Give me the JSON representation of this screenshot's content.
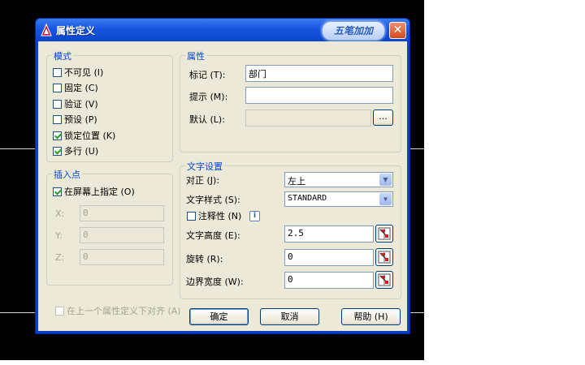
{
  "dialog": {
    "title": "属性定义",
    "brand_text": "五笔加加",
    "close_symbol": "✕"
  },
  "mode": {
    "title": "模式",
    "options": [
      {
        "label": "不可见 (I)",
        "checked": false
      },
      {
        "label": "固定 (C)",
        "checked": false
      },
      {
        "label": "验证 (V)",
        "checked": false
      },
      {
        "label": "预设 (P)",
        "checked": false
      },
      {
        "label": "锁定位置 (K)",
        "checked": true
      },
      {
        "label": "多行 (U)",
        "checked": true
      }
    ]
  },
  "insertion": {
    "title": "插入点",
    "specify_on_screen": "在屏幕上指定 (O)",
    "x_label": "X:",
    "y_label": "Y:",
    "z_label": "Z:",
    "x_value": "0",
    "y_value": "0",
    "z_value": "0"
  },
  "attribute": {
    "title": "属性",
    "tag_label": "标记 (T):",
    "tag_value": "部门",
    "prompt_label": "提示 (M):",
    "prompt_value": "",
    "default_label": "默认 (L):",
    "default_value": "",
    "browse_label": "..."
  },
  "text_settings": {
    "title": "文字设置",
    "justify_label": "对正 (J):",
    "justify_value": "左上",
    "style_label": "文字样式 (S):",
    "style_value": "STANDARD",
    "annotative_label": "注释性 (N)",
    "info_symbol": "i",
    "height_label": "文字高度 (E):",
    "height_value": "2.5",
    "rotation_label": "旋转 (R):",
    "rotation_value": "0",
    "boundary_label": "边界宽度 (W):",
    "boundary_value": "0"
  },
  "align_below": "在上一个属性定义下对齐 (A)",
  "buttons": {
    "ok": "确定",
    "cancel": "取消",
    "help": "帮助 (H)"
  },
  "colors": {
    "title_bar": "#1656e0",
    "group_title": "#0046d5",
    "dialog_face": "#ece9d8"
  }
}
